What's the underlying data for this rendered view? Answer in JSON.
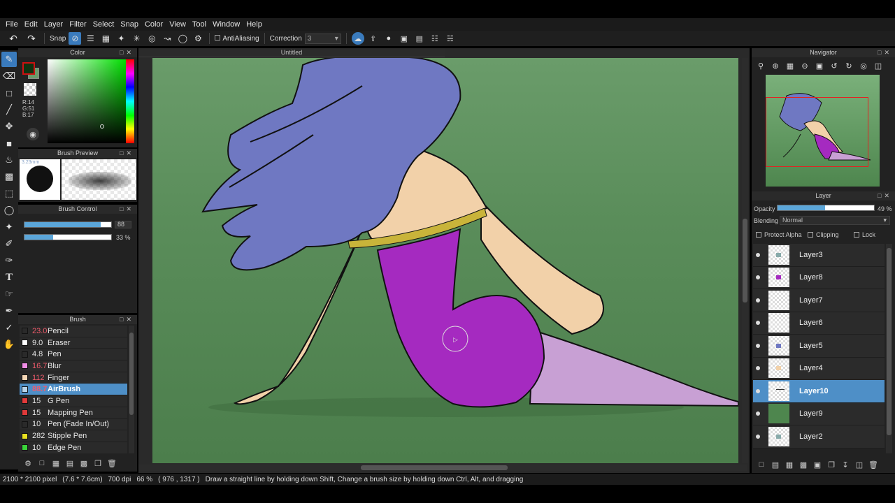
{
  "menu": [
    "File",
    "Edit",
    "Layer",
    "Filter",
    "Select",
    "Snap",
    "Color",
    "View",
    "Tool",
    "Window",
    "Help"
  ],
  "toolbar": {
    "snap_label": "Snap",
    "antialias_label": "AntiAliasing",
    "correction_label": "Correction",
    "correction_value": "3"
  },
  "color_panel": {
    "title": "Color",
    "rgb_text": "R:14\nG:51\nB:17",
    "fg_color": "#0e3311"
  },
  "brush_preview": {
    "title": "Brush Preview",
    "size_text": "3.23mm"
  },
  "brush_control": {
    "title": "Brush Control",
    "size_value": "88",
    "size_fraction": 0.88,
    "opacity_text": "33 %",
    "opacity_fraction": 0.33
  },
  "brush_panel": {
    "title": "Brush",
    "items": [
      {
        "size": "23.0",
        "name": "Pencil",
        "color": "#2a2a2a",
        "red": true
      },
      {
        "size": "9.0",
        "name": "Eraser",
        "color": "#ffffff",
        "red": false
      },
      {
        "size": "4.8",
        "name": "Pen",
        "color": "#2a2a2a",
        "red": false
      },
      {
        "size": "16.7",
        "name": "Blur",
        "color": "#f08ee6",
        "red": true
      },
      {
        "size": "112",
        "name": "Finger",
        "color": "#f5d7b5",
        "red": true
      },
      {
        "size": "88.7",
        "name": "AirBrush",
        "color": "#b8d4ea",
        "red": true
      },
      {
        "size": "15",
        "name": "G Pen",
        "color": "#e03a3a",
        "red": false
      },
      {
        "size": "15",
        "name": "Mapping Pen",
        "color": "#e03a3a",
        "red": false
      },
      {
        "size": "10",
        "name": "Pen (Fade In/Out)",
        "color": "#2a2a2a",
        "red": false
      },
      {
        "size": "282",
        "name": "Stipple Pen",
        "color": "#e8e020",
        "red": false
      },
      {
        "size": "10",
        "name": "Edge Pen",
        "color": "#3ad43a",
        "red": false
      }
    ],
    "selected_index": 5
  },
  "canvas": {
    "tab_title": "Untitled"
  },
  "navigator": {
    "title": "Navigator"
  },
  "layer_panel": {
    "title": "Layer",
    "opacity_label": "Opacity",
    "opacity_text": "49 %",
    "opacity_fraction": 0.49,
    "blending_label": "Blending",
    "blending_value": "Normal",
    "protect_alpha_label": "Protect Alpha",
    "clipping_label": "Clipping",
    "lock_label": "Lock",
    "layers": [
      {
        "name": "Layer3",
        "thumb": "sketch"
      },
      {
        "name": "Layer8",
        "thumb": "purple"
      },
      {
        "name": "Layer7",
        "thumb": "blank"
      },
      {
        "name": "Layer6",
        "thumb": "blank"
      },
      {
        "name": "Layer5",
        "thumb": "blue"
      },
      {
        "name": "Layer4",
        "thumb": "skin"
      },
      {
        "name": "Layer10",
        "thumb": "line"
      },
      {
        "name": "Layer9",
        "thumb": "green"
      },
      {
        "name": "Layer2",
        "thumb": "sketch"
      }
    ],
    "selected_index": 6
  },
  "status": {
    "pixel_size": "2100 * 2100 pixel",
    "cm_size": "(7.6 * 7.6cm)",
    "dpi": "700 dpi",
    "zoom": "66 %",
    "coords": "( 976 , 1317 )",
    "hint": "Draw a straight line by holding down Shift, Change a brush size by holding down Ctrl, Alt, and dragging"
  }
}
